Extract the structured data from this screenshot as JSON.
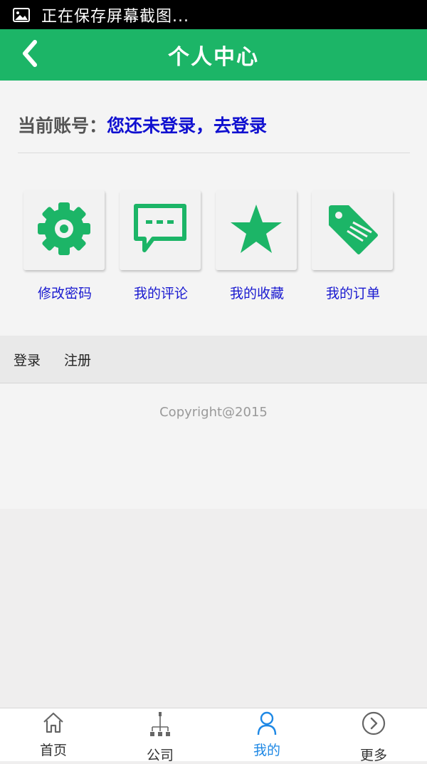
{
  "status_bar": {
    "text": "正在保存屏幕截图...",
    "icon": "image-icon"
  },
  "header": {
    "title": "个人中心",
    "back_icon": "chevron-left-icon"
  },
  "account": {
    "label": "当前账号：",
    "link": "您还未登录，去登录"
  },
  "grid": [
    {
      "label": "修改密码",
      "icon": "gear-icon"
    },
    {
      "label": "我的评论",
      "icon": "comment-icon"
    },
    {
      "label": "我的收藏",
      "icon": "star-icon"
    },
    {
      "label": "我的订单",
      "icon": "tag-icon"
    }
  ],
  "links": {
    "login": "登录",
    "register": "注册"
  },
  "footer": {
    "copyright": "Copyright@2015"
  },
  "tabbar": [
    {
      "label": "首页",
      "icon": "home-icon"
    },
    {
      "label": "公司",
      "icon": "org-chart-icon"
    },
    {
      "label": "我的",
      "icon": "user-icon",
      "active": true
    },
    {
      "label": "更多",
      "icon": "circle-chevron-right-icon"
    }
  ],
  "colors": {
    "brand_green": "#1cb567",
    "link_blue": "#1010d0",
    "active_tab": "#1e88e5"
  }
}
